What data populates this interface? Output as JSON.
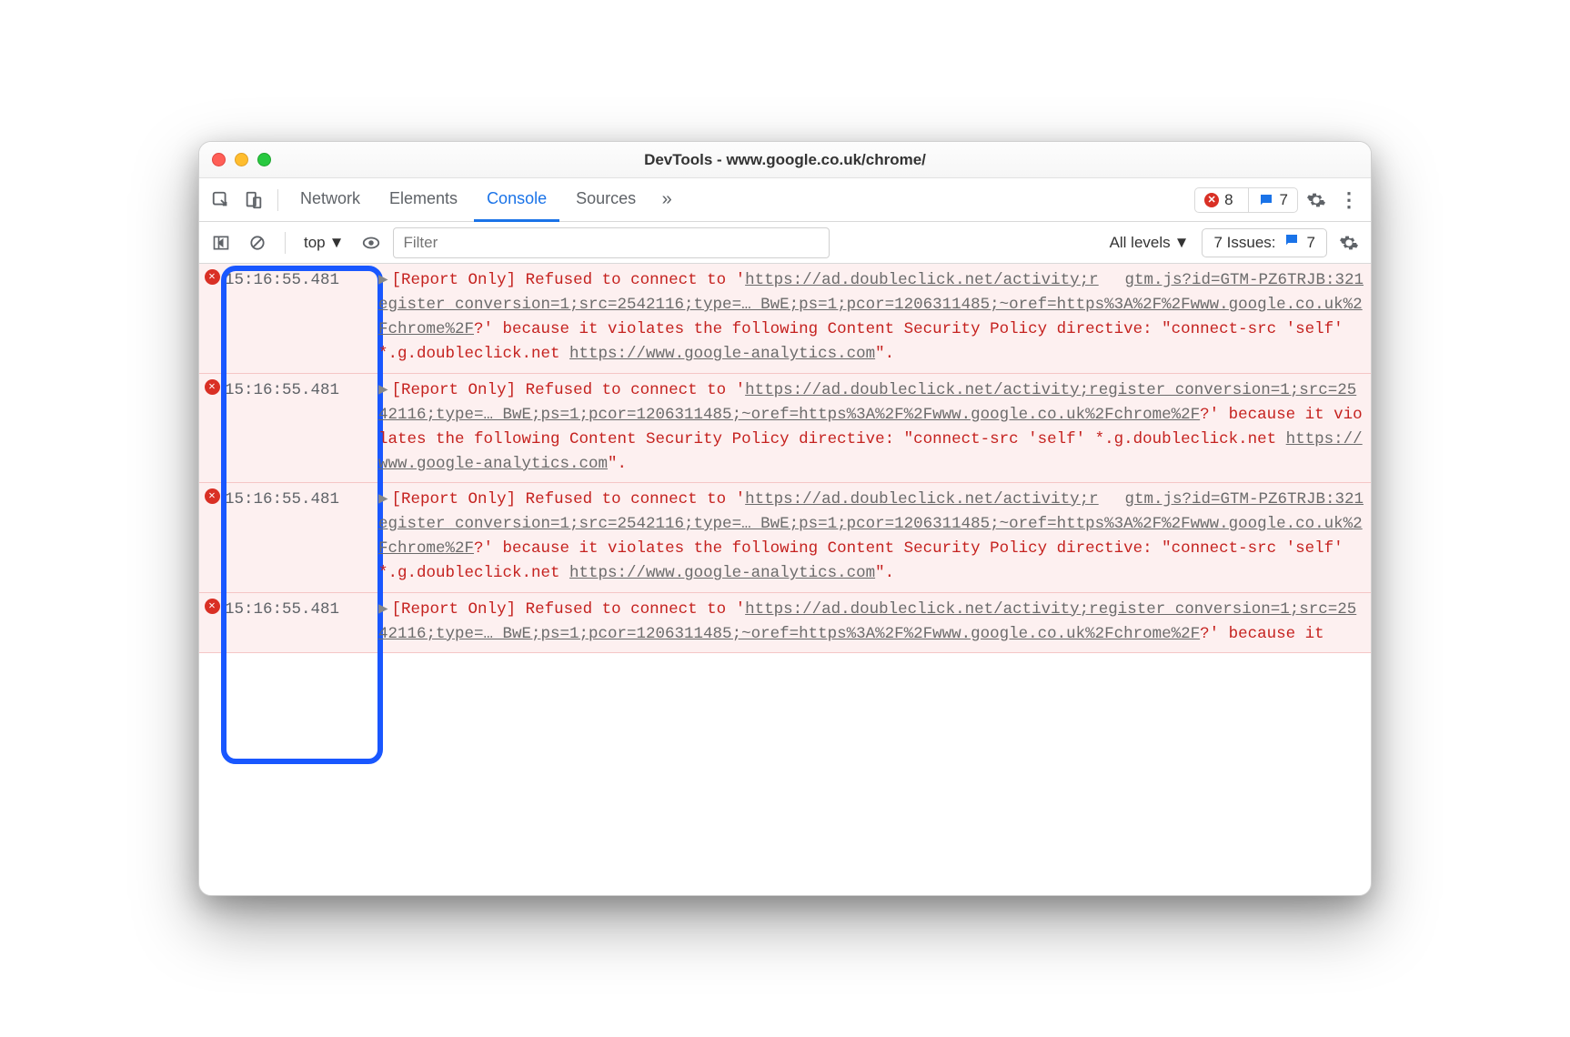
{
  "window": {
    "title": "DevTools - www.google.co.uk/chrome/"
  },
  "tabs": {
    "items": [
      "Network",
      "Elements",
      "Console",
      "Sources"
    ],
    "active": "Console",
    "more_glyph": "»",
    "error_count": "8",
    "message_count": "7"
  },
  "toolbar": {
    "context": "top",
    "filter_placeholder": "Filter",
    "levels": "All levels",
    "issues_label": "7 Issues:",
    "issues_count": "7"
  },
  "messages": [
    {
      "timestamp": "15:16:55.481",
      "source": "gtm.js?id=GTM-PZ6TRJB:321",
      "prefix": "[Report Only] Refused to connect to '",
      "url": "https://ad.doubleclick.net/activity;register_conversion=1;src=2542116;type=… BwE;ps=1;pcor=1206311485;~oref=https%3A%2F%2Fwww.google.co.uk%2Fchrome%2F",
      "mid": "?' because it violates the following Content Security Policy directive: \"connect-src 'self' *.g.doubleclick.net ",
      "link": "https://www.google-analytics.com",
      "suffix": "\"."
    },
    {
      "timestamp": "15:16:55.481",
      "source": "",
      "prefix": "[Report Only] Refused to connect to '",
      "url": "https://ad.doubleclick.net/activity;register_conversion=1;src=2542116;type=… BwE;ps=1;pcor=1206311485;~oref=https%3A%2F%2Fwww.google.co.uk%2Fchrome%2F",
      "mid": "?' because it violates the following Content Security Policy directive: \"connect-src 'self' *.g.doubleclick.net ",
      "link": "https://www.google-analytics.com",
      "suffix": "\"."
    },
    {
      "timestamp": "15:16:55.481",
      "source": "gtm.js?id=GTM-PZ6TRJB:321",
      "prefix": "[Report Only] Refused to connect to '",
      "url": "https://ad.doubleclick.net/activity;register_conversion=1;src=2542116;type=… BwE;ps=1;pcor=1206311485;~oref=https%3A%2F%2Fwww.google.co.uk%2Fchrome%2F",
      "mid": "?' because it violates the following Content Security Policy directive: \"connect-src 'self' *.g.doubleclick.net ",
      "link": "https://www.google-analytics.com",
      "suffix": "\"."
    },
    {
      "timestamp": "15:16:55.481",
      "source": "",
      "prefix": "[Report Only] Refused to connect to '",
      "url": "https://ad.doubleclick.net/activity;register_conversion=1;src=2542116;type=… BwE;ps=1;pcor=1206311485;~oref=https%3A%2F%2Fwww.google.co.uk%2Fchrome%2F",
      "mid": "?' because it",
      "link": "",
      "suffix": ""
    }
  ],
  "colors": {
    "error_text": "#c5221f",
    "error_bg": "#fdf0f0",
    "accent": "#1a73e8",
    "highlight": "#1957ff"
  }
}
